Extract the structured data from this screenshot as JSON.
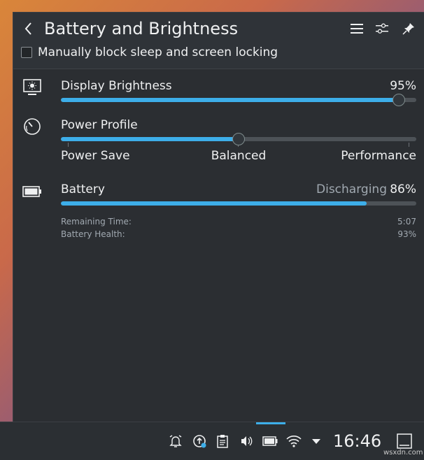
{
  "header": {
    "title": "Battery and Brightness",
    "back_icon": "chevron-left-icon",
    "menu_icon": "hamburger-menu-icon",
    "configure_icon": "configure-sliders-icon",
    "pin_icon": "pin-icon"
  },
  "inhibit": {
    "label": "Manually block sleep and screen locking",
    "checked": false
  },
  "brightness": {
    "label": "Display Brightness",
    "value_text": "95%",
    "value": 0.95,
    "icon": "monitor-brightness-icon"
  },
  "power_profile": {
    "label": "Power Profile",
    "icon": "speedometer-icon",
    "options": [
      "Power Save",
      "Balanced",
      "Performance"
    ],
    "selected_index": 1
  },
  "battery": {
    "label": "Battery",
    "status": "Discharging",
    "percent_text": "86%",
    "level": 0.86,
    "icon": "battery-icon",
    "remaining_label": "Remaining Time:",
    "remaining_value": "5:07",
    "health_label": "Battery Health:",
    "health_value": "93%"
  },
  "taskbar": {
    "clock": "16:46",
    "tray_icons": [
      "alarm-icon",
      "updates-icon",
      "clipboard-icon",
      "volume-icon",
      "battery-tray-icon",
      "wifi-icon",
      "tray-expand-arrow-icon",
      "show-desktop-icon"
    ]
  },
  "watermark": "wsxdn.com",
  "colors": {
    "accent": "#3daee9",
    "background": "#2b2e32",
    "text": "#eff0f1",
    "muted": "#a1a9b1"
  }
}
